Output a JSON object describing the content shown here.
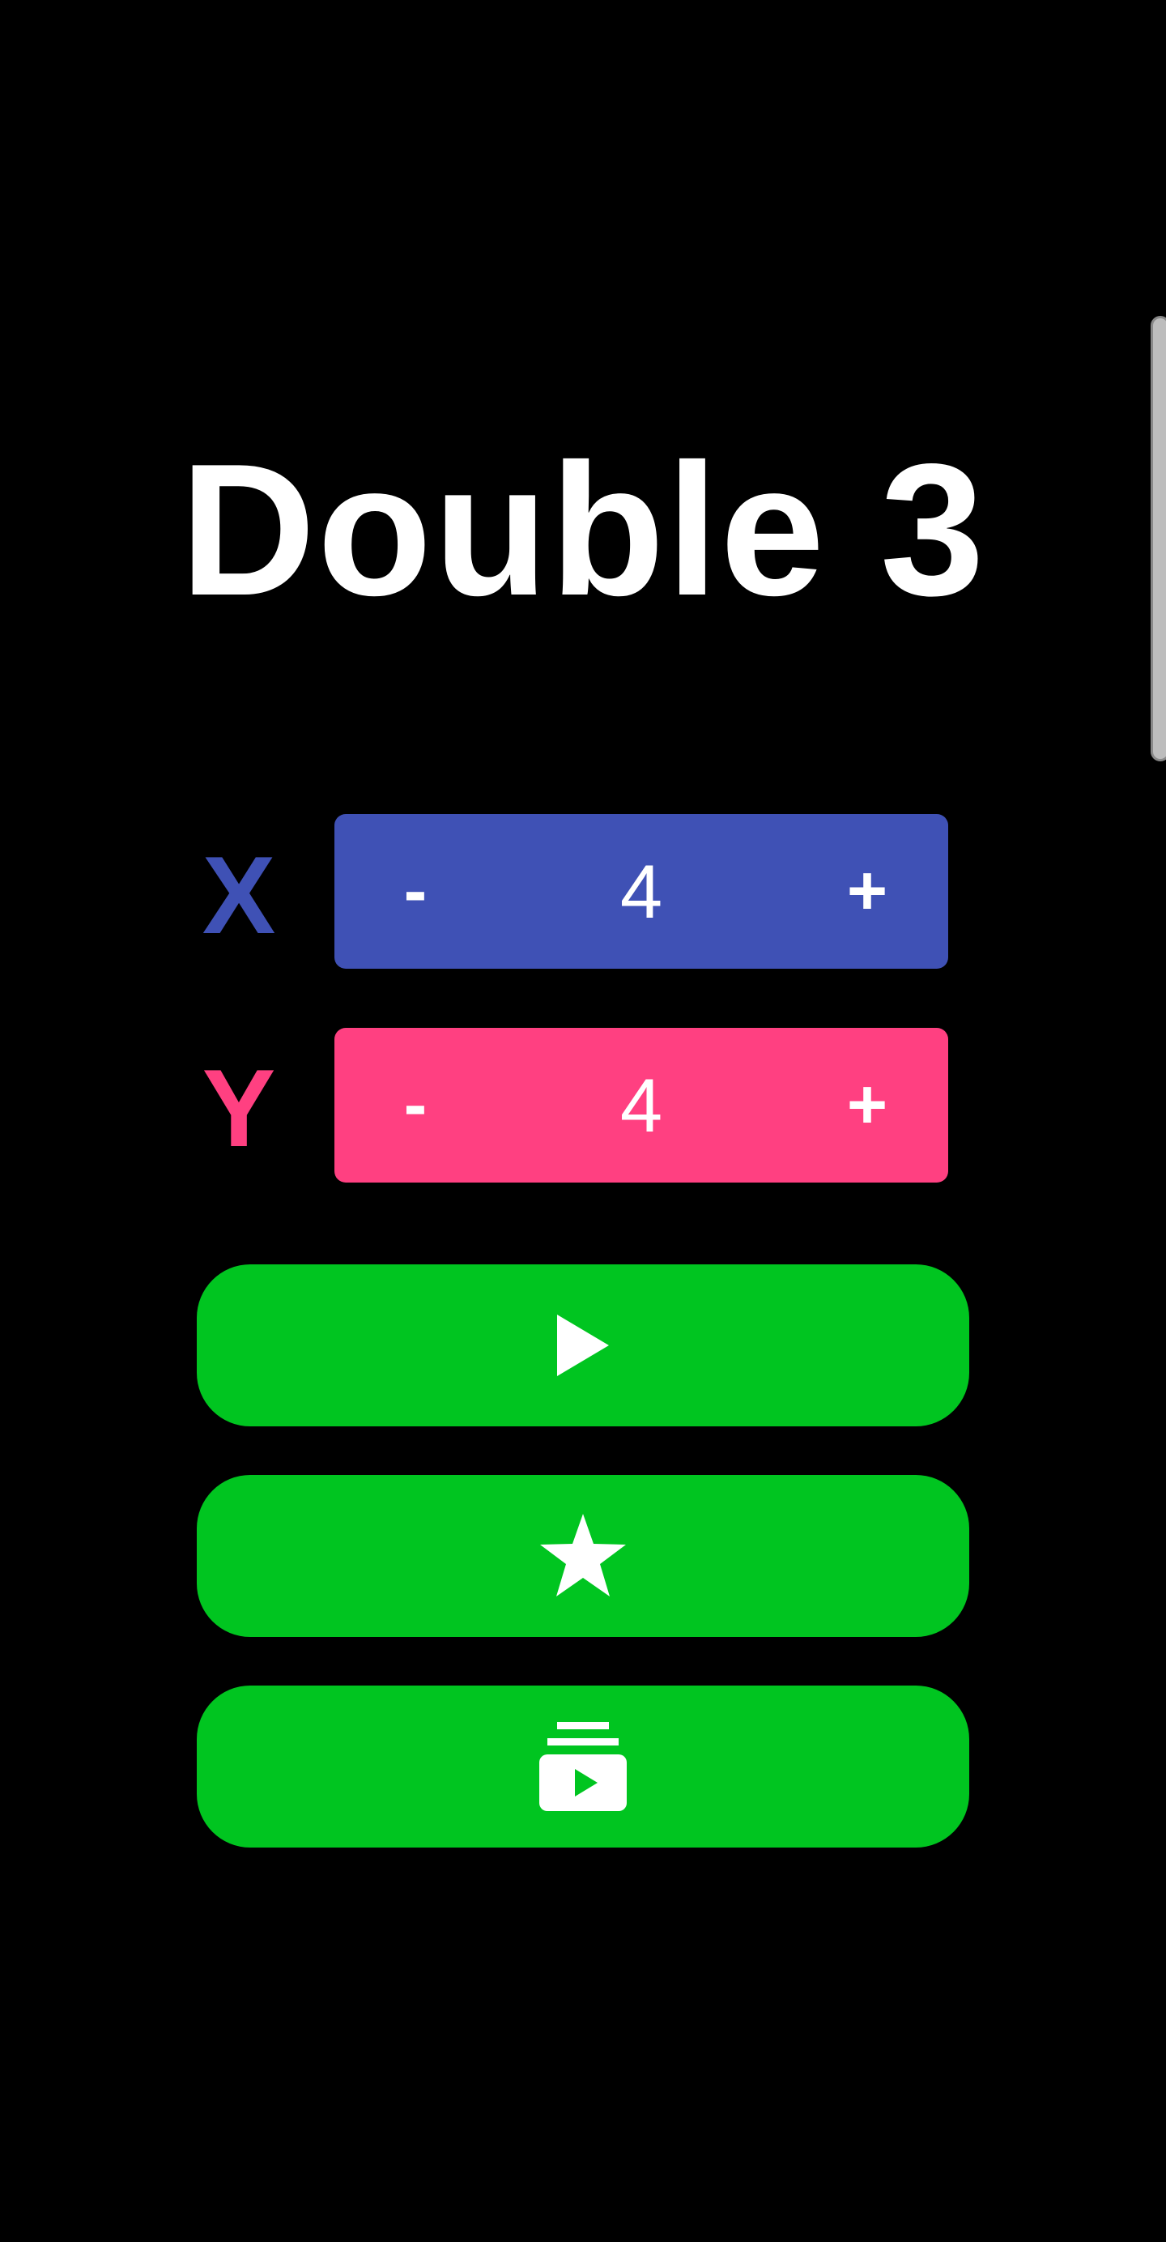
{
  "game": {
    "title": "Double 3"
  },
  "controls": {
    "x": {
      "label": "X",
      "minus_label": "-",
      "value": "4",
      "plus_label": "+",
      "color": "#3f51b5"
    },
    "y": {
      "label": "Y",
      "minus_label": "-",
      "value": "4",
      "plus_label": "+",
      "color": "#ff4081"
    }
  },
  "actions": [
    {
      "name": "play",
      "icon": "play-icon"
    },
    {
      "name": "rate",
      "icon": "star-icon"
    },
    {
      "name": "more-games",
      "icon": "video-library-icon"
    }
  ],
  "colors": {
    "background": "#000000",
    "action_button": "#00c520",
    "text": "#ffffff"
  }
}
